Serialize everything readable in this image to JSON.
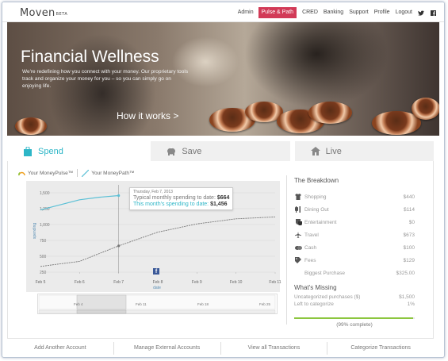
{
  "header": {
    "logo": "Moven",
    "logo_badge": "BETA",
    "nav": [
      "Admin",
      "Pulse & Path",
      "CRED",
      "Banking",
      "Support",
      "Profile",
      "Logout"
    ],
    "active_nav": "Pulse & Path",
    "social_icons": [
      "twitter-icon",
      "facebook-icon"
    ]
  },
  "hero": {
    "title": "Financial Wellness",
    "subtitle": "We're redefining how you connect with your money. Our proprietary tools track and organize your money for you – so you can simply go on enjoying life.",
    "cta": "How it works >"
  },
  "tabs": [
    {
      "label": "Spend",
      "icon": "shopping-bag-icon",
      "active": true
    },
    {
      "label": "Save",
      "icon": "piggy-bank-icon",
      "active": false
    },
    {
      "label": "Live",
      "icon": "house-icon",
      "active": false
    }
  ],
  "modes": {
    "pulse": "Your MoneyPulse™",
    "path": "Your MoneyPath™"
  },
  "chart": {
    "tooltip_date": "Thursday, Feb 7, 2013",
    "tooltip_typical_label": "Typical monthly spending to date:",
    "tooltip_typical_value": "$664",
    "tooltip_month_label": "This month's spending to date:",
    "tooltip_month_value": "$1,456",
    "fb_glyph": "f"
  },
  "chart_data": {
    "type": "line",
    "ylabel": "spending",
    "xlabel": "date",
    "x": [
      "Feb 5",
      "Feb 6",
      "Feb 7",
      "Feb 8",
      "Feb 9",
      "Feb 10",
      "Feb 11"
    ],
    "yticks": [
      "1,500",
      "1,250",
      "1,000",
      "750",
      "500",
      "250"
    ],
    "ylim": [
      250,
      1600
    ],
    "series": [
      {
        "name": "This month's spending to date",
        "color": "#5bc0d6",
        "x": [
          0,
          0.5,
          1,
          1.5,
          2
        ],
        "values": [
          1230,
          1310,
          1390,
          1430,
          1456
        ]
      },
      {
        "name": "Typical monthly spending to date",
        "color": "#777777",
        "x": [
          0,
          1,
          2,
          3,
          4,
          5,
          6
        ],
        "values": [
          340,
          420,
          664,
          880,
          1010,
          1090,
          1120
        ]
      }
    ],
    "cursor_x": 2,
    "navigator_labels": [
      "Feb 4",
      "Feb 11",
      "Feb 18",
      "Feb 25"
    ]
  },
  "breakdown": {
    "title": "The Breakdown",
    "items": [
      {
        "label": "Shopping",
        "value": "$440",
        "icon": "shirt-icon"
      },
      {
        "label": "Dining Out",
        "value": "$114",
        "icon": "cutlery-icon"
      },
      {
        "label": "Entertainment",
        "value": "$0",
        "icon": "theater-icon"
      },
      {
        "label": "Travel",
        "value": "$673",
        "icon": "airplane-icon"
      },
      {
        "label": "Cash",
        "value": "$100",
        "icon": "cash-icon"
      },
      {
        "label": "Fees",
        "value": "$129",
        "icon": "fees-icon"
      }
    ],
    "biggest_label": "Biggest Purchase",
    "biggest_value": "$325.00",
    "missing_title": "What's Missing",
    "uncategorized_label": "Uncategorized purchases ($)",
    "uncategorized_value": "$1,500",
    "left_label": "Left to categorize",
    "left_value": "1%",
    "progress_fraction": 0.99,
    "progress_label": "(99% complete)"
  },
  "footer": [
    "Add Another Account",
    "Manage External Accounts",
    "View all Transactions",
    "Categorize Transactions"
  ],
  "colors": {
    "accent": "#2eb6c7",
    "active_nav": "#d23a57",
    "progress": "#8cc63f"
  }
}
